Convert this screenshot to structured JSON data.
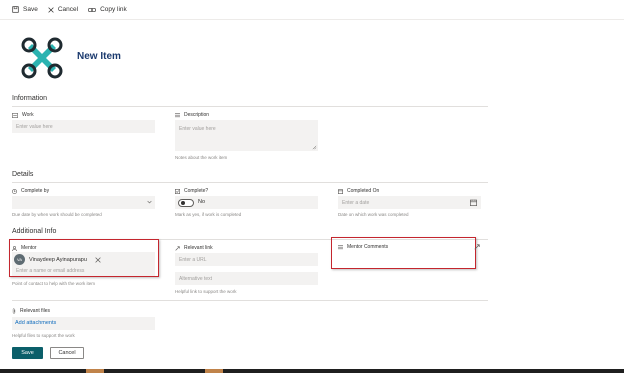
{
  "toolbar": {
    "save": "Save",
    "cancel": "Cancel",
    "copy_link": "Copy link"
  },
  "form": {
    "title": "New Item"
  },
  "sections": {
    "information": "Information",
    "details": "Details",
    "additional": "Additional Info"
  },
  "fields": {
    "work": {
      "label": "Work",
      "placeholder": "Enter value here"
    },
    "description": {
      "label": "Description",
      "placeholder": "Enter value here",
      "hint": "Notes about the work item"
    },
    "complete_by": {
      "label": "Complete by",
      "hint": "Due date by when work should be completed"
    },
    "complete": {
      "label": "Complete?",
      "value": "No",
      "hint": "Mark as yes, if work is completed"
    },
    "completed_on": {
      "label": "Completed On",
      "placeholder": "Enter a date",
      "hint": "Date on which work was completed"
    },
    "mentor": {
      "label": "Mentor",
      "person_initials": "VA",
      "person_name": "Vinaydeep Ayinapurapu",
      "placeholder": "Enter a name or email address",
      "hint": "Point of contact to help with the work item"
    },
    "relevant_link": {
      "label": "Relevant link",
      "url_placeholder": "Enter a URL",
      "alt_placeholder": "Alternative text",
      "hint": "Helpful link to support the work"
    },
    "mentor_comments": {
      "label": "Mentor Comments"
    },
    "relevant_files": {
      "label": "Relevant files",
      "action": "Add attachments",
      "hint": "Helpful files to support the work"
    }
  },
  "actions": {
    "save": "Save",
    "cancel": "Cancel"
  },
  "colors": {
    "accent": "#0b5f6a",
    "highlight": "#c4262e",
    "title": "#1b3a6e",
    "logo": "#2bb3b1"
  }
}
